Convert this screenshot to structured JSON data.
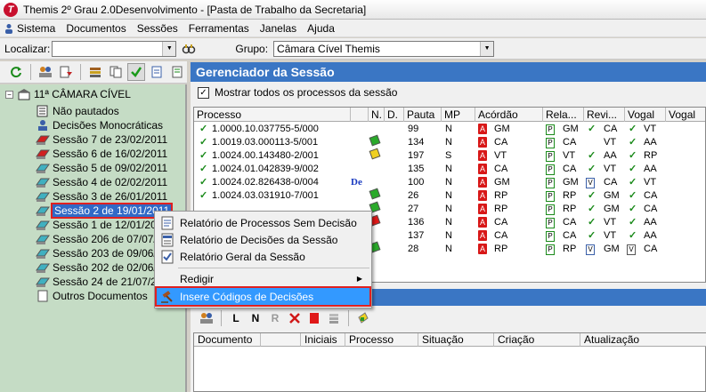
{
  "window": {
    "title": "Themis 2º Grau 2.0Desenvolvimento - [Pasta de Trabalho da Secretaria]"
  },
  "menu": [
    "Sistema",
    "Documentos",
    "Sessões",
    "Ferramentas",
    "Janelas",
    "Ajuda"
  ],
  "locbar": {
    "localizar_label": "Localizar:",
    "localizar_value": "",
    "grupo_label": "Grupo:",
    "grupo_value": "Câmara Cível Themis"
  },
  "tree": {
    "root": "11ª CÂMARA CÍVEL",
    "items": [
      "Não pautados",
      "Decisões Monocráticas",
      "Sessão 7 de 23/02/2011",
      "Sessão 6 de 16/02/2011",
      "Sessão 5 de 09/02/2011",
      "Sessão 4 de 02/02/2011",
      "Sessão 3 de 26/01/2011",
      "Sessão 2 de 19/01/2011",
      "Sessão 1 de 12/01/20",
      "Sessão 206 de 07/07/2",
      "Sessão 203 de 09/06/2",
      "Sessão 202 de 02/06/2",
      "Sessão 24 de 21/07/20",
      "Outros Documentos"
    ]
  },
  "context_menu": {
    "items": [
      "Relatório de Processos Sem Decisão",
      "Relatório de Decisões da Sessão",
      "Relatório Geral da Sessão",
      "Redigir",
      "Insere Códigos de Decisões"
    ]
  },
  "session_panel": {
    "title": "Gerenciador da Sessão",
    "show_all_label": "Mostrar todos os processos da sessão",
    "show_all_checked": "✓",
    "columns": [
      "Processo",
      "N.",
      "D.",
      "Pauta",
      "MP",
      "Acórdão",
      "Rela...",
      "Revi...",
      "Vogal",
      "Vogal"
    ],
    "rows": [
      {
        "processo": "1.0000.10.037755-5/000",
        "flag": "",
        "de": "",
        "pauta": "99",
        "mp": "N",
        "acordao": "GM",
        "rela": "GM",
        "revi_chk": "✓",
        "revi": "CA",
        "vogal_chk": "✓",
        "vogal": "VT"
      },
      {
        "processo": "1.0019.03.000113-5/001",
        "flag": "green",
        "de": "",
        "pauta": "134",
        "mp": "N",
        "acordao": "CA",
        "rela": "CA",
        "revi_chk": "",
        "revi": "VT",
        "vogal_chk": "✓",
        "vogal": "AA"
      },
      {
        "processo": "1.0024.00.143480-2/001",
        "flag": "yellow",
        "de": "",
        "pauta": "197",
        "mp": "S",
        "acordao": "VT",
        "rela": "VT",
        "revi_chk": "✓",
        "revi": "AA",
        "vogal_chk": "✓",
        "vogal": "RP"
      },
      {
        "processo": "1.0024.01.042839-9/002",
        "flag": "",
        "de": "",
        "pauta": "135",
        "mp": "N",
        "acordao": "CA",
        "rela": "CA",
        "revi_chk": "✓",
        "revi": "VT",
        "vogal_chk": "✓",
        "vogal": "AA"
      },
      {
        "processo": "1.0024.02.826438-0/004",
        "flag": "",
        "de": "De",
        "pauta": "100",
        "mp": "N",
        "acordao": "GM",
        "rela": "GM",
        "revi_chk": "V",
        "revi": "CA",
        "vogal_chk": "✓",
        "vogal": "VT"
      },
      {
        "processo": "1.0024.03.031910-7/001",
        "flag": "green",
        "de": "",
        "pauta": "26",
        "mp": "N",
        "acordao": "RP",
        "rela": "RP",
        "revi_chk": "✓",
        "revi": "GM",
        "vogal_chk": "✓",
        "vogal": "CA"
      },
      {
        "processo": "",
        "flag": "green",
        "de": "",
        "pauta": "27",
        "mp": "N",
        "acordao": "RP",
        "rela": "RP",
        "revi_chk": "✓",
        "revi": "GM",
        "vogal_chk": "✓",
        "vogal": "CA"
      },
      {
        "processo": "",
        "flag": "red",
        "de": "",
        "pauta": "136",
        "mp": "N",
        "acordao": "CA",
        "rela": "CA",
        "revi_chk": "✓",
        "revi": "VT",
        "vogal_chk": "✓",
        "vogal": "AA"
      },
      {
        "processo": "",
        "flag": "",
        "de": "",
        "pauta": "137",
        "mp": "N",
        "acordao": "CA",
        "rela": "CA",
        "revi_chk": "✓",
        "revi": "VT",
        "vogal_chk": "✓",
        "vogal": "AA"
      },
      {
        "processo": "",
        "flag": "green",
        "de": "",
        "pauta": "28",
        "mp": "N",
        "acordao": "RP",
        "rela": "RP",
        "revi_chk": "V",
        "revi": "GM",
        "vogal_chk": "V",
        "vogal": "CA"
      }
    ]
  },
  "documents_panel": {
    "toolbar": [
      "L",
      "N",
      "R"
    ],
    "columns": [
      "Documento",
      "Iniciais",
      "Processo",
      "Situação",
      "Criação",
      "Atualização"
    ]
  }
}
